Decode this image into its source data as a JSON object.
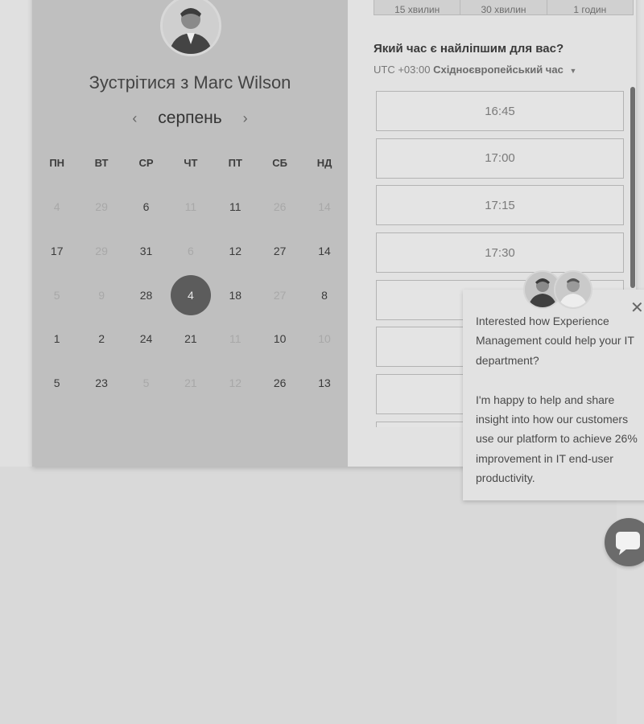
{
  "host": {
    "title": "Зустрітися з Marc Wilson"
  },
  "calendar": {
    "month": "серпень",
    "prev_icon": "chevron-left-icon",
    "next_icon": "chevron-right-icon",
    "weekdays": [
      "ПН",
      "ВТ",
      "СР",
      "ЧТ",
      "ПТ",
      "СБ",
      "НД"
    ],
    "rows": [
      [
        {
          "d": "4",
          "m": true
        },
        {
          "d": "29",
          "m": true
        },
        {
          "d": "6",
          "m": false
        },
        {
          "d": "11",
          "m": true
        },
        {
          "d": "11",
          "m": false
        },
        {
          "d": "26",
          "m": true
        },
        {
          "d": "14",
          "m": true
        }
      ],
      [
        {
          "d": "17",
          "m": false
        },
        {
          "d": "29",
          "m": true
        },
        {
          "d": "31",
          "m": false
        },
        {
          "d": "6",
          "m": true
        },
        {
          "d": "12",
          "m": false
        },
        {
          "d": "27",
          "m": false
        },
        {
          "d": "14",
          "m": false
        }
      ],
      [
        {
          "d": "5",
          "m": true
        },
        {
          "d": "9",
          "m": true
        },
        {
          "d": "28",
          "m": false
        },
        {
          "d": "4",
          "m": false,
          "selected": true
        },
        {
          "d": "18",
          "m": false
        },
        {
          "d": "27",
          "m": true
        },
        {
          "d": "8",
          "m": false
        }
      ],
      [
        {
          "d": "1",
          "m": false
        },
        {
          "d": "2",
          "m": false
        },
        {
          "d": "24",
          "m": false
        },
        {
          "d": "21",
          "m": false
        },
        {
          "d": "11",
          "m": true
        },
        {
          "d": "10",
          "m": false
        },
        {
          "d": "10",
          "m": true
        }
      ],
      [
        {
          "d": "5",
          "m": false
        },
        {
          "d": "23",
          "m": false
        },
        {
          "d": "5",
          "m": true
        },
        {
          "d": "21",
          "m": true
        },
        {
          "d": "12",
          "m": true
        },
        {
          "d": "26",
          "m": false
        },
        {
          "d": "13",
          "m": false
        }
      ]
    ]
  },
  "durations": [
    "15 хвилин",
    "30 хвилин",
    "1 годин"
  ],
  "question": "Який час є найліпшим для вас?",
  "timezone": {
    "prefix": "UTC +03:00",
    "name": "Східноєвропейський час"
  },
  "slots": [
    "16:45",
    "17:00",
    "17:15",
    "17:30",
    "",
    "",
    "",
    ""
  ],
  "chat": {
    "message_1": "Interested how Experience Management could help your IT department?",
    "message_2": "I'm happy to help and share insight into how our customers use our platform to achieve 26% improvement in IT end-user productivity.",
    "close_icon": "close-icon",
    "launcher_icon": "chat-bubble-icon"
  }
}
